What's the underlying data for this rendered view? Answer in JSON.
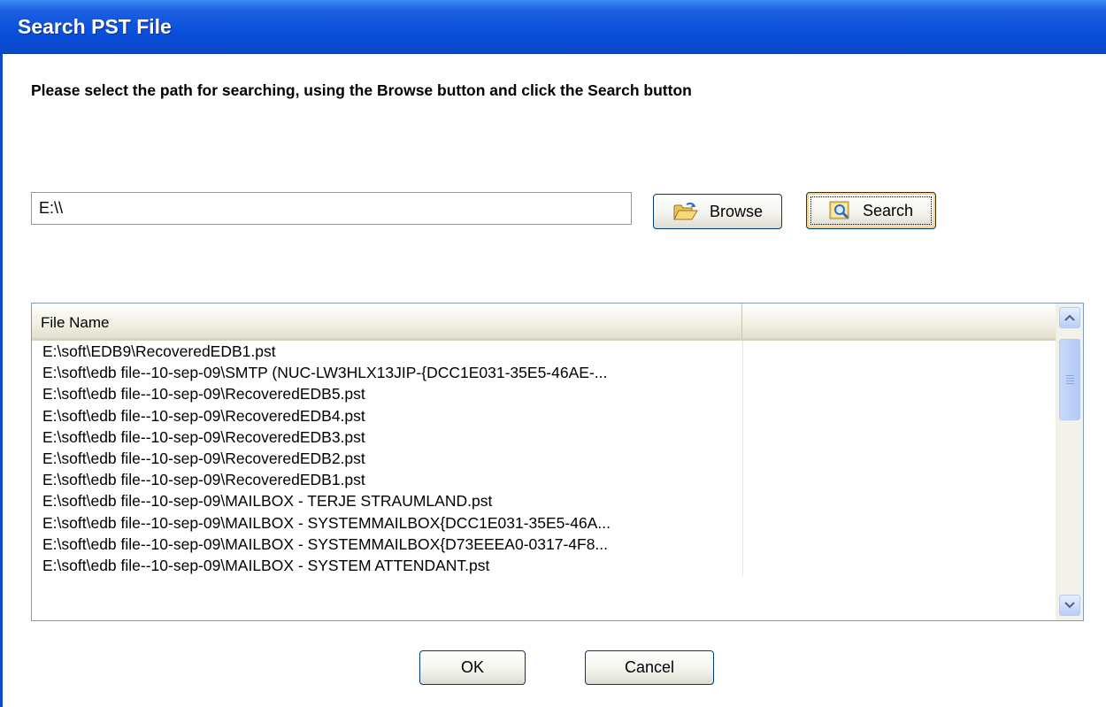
{
  "window": {
    "title": "Search PST File"
  },
  "instruction": "Please select the path for searching, using the Browse button and click the Search button",
  "path_input": {
    "value": "E:\\\\"
  },
  "buttons": {
    "browse": "Browse",
    "search": "Search",
    "ok": "OK",
    "cancel": "Cancel"
  },
  "table": {
    "columns": [
      "File Name",
      ""
    ],
    "rows": [
      "E:\\soft\\EDB9\\RecoveredEDB1.pst",
      "E:\\soft\\edb file--10-sep-09\\SMTP (NUC-LW3HLX13JIP-{DCC1E031-35E5-46AE-...",
      "E:\\soft\\edb file--10-sep-09\\RecoveredEDB5.pst",
      "E:\\soft\\edb file--10-sep-09\\RecoveredEDB4.pst",
      "E:\\soft\\edb file--10-sep-09\\RecoveredEDB3.pst",
      "E:\\soft\\edb file--10-sep-09\\RecoveredEDB2.pst",
      "E:\\soft\\edb file--10-sep-09\\RecoveredEDB1.pst",
      "E:\\soft\\edb file--10-sep-09\\MAILBOX - TERJE STRAUMLAND.pst",
      "E:\\soft\\edb file--10-sep-09\\MAILBOX - SYSTEMMAILBOX{DCC1E031-35E5-46A...",
      "E:\\soft\\edb file--10-sep-09\\MAILBOX - SYSTEMMAILBOX{D73EEEA0-0317-4F8...",
      "E:\\soft\\edb file--10-sep-09\\MAILBOX - SYSTEM ATTENDANT.pst"
    ]
  },
  "icons": {
    "browse": "open-folder-icon",
    "search": "magnifier-icon",
    "scroll_up": "chevron-up-icon",
    "scroll_down": "chevron-down-icon"
  },
  "colors": {
    "titlebar": "#0a4fdc",
    "button_border": "#003c74",
    "focus_ring": "#f7d383",
    "header_bg": "#f1efe2"
  }
}
